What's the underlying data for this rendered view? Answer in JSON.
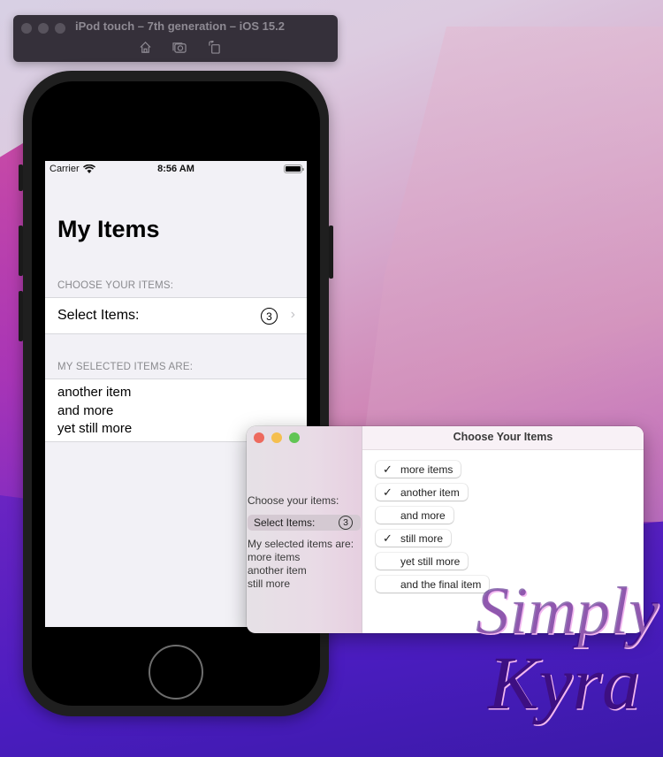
{
  "simulator": {
    "title": "iPod touch – 7th generation – iOS 15.2",
    "tools": [
      {
        "icon": "home-icon",
        "label": "Home"
      },
      {
        "icon": "screenshot-icon",
        "label": "Screenshot"
      },
      {
        "icon": "rotate-icon",
        "label": "Rotate"
      }
    ]
  },
  "ios_app": {
    "status_bar": {
      "carrier": "Carrier",
      "time": "8:56 AM"
    },
    "nav_title": "My Items",
    "section1_header": "CHOOSE YOUR ITEMS:",
    "select_label": "Select Items:",
    "select_count": "3",
    "section2_header": "MY SELECTED ITEMS ARE:",
    "selected_items": [
      "another item",
      "and more",
      "yet still more"
    ]
  },
  "mac_app": {
    "window_title": "Choose Your Items",
    "sidebar": {
      "choose_label": "Choose your items:",
      "select_label": "Select Items:",
      "select_count": "3",
      "selected_label": "My selected items are:",
      "selected_items": [
        "more items",
        "another item",
        "still more"
      ]
    },
    "items": [
      {
        "label": "more items",
        "checked": true
      },
      {
        "label": "another item",
        "checked": true
      },
      {
        "label": "and more",
        "checked": false
      },
      {
        "label": "still more",
        "checked": true
      },
      {
        "label": "yet still more",
        "checked": false
      },
      {
        "label": "and the final item",
        "checked": false
      }
    ],
    "traffic_lights": {
      "close": "#ed6a5e",
      "minimize": "#f5bf4f",
      "zoom": "#61c554"
    }
  },
  "watermark": {
    "line1": "Simply",
    "line2": "Kyra"
  }
}
